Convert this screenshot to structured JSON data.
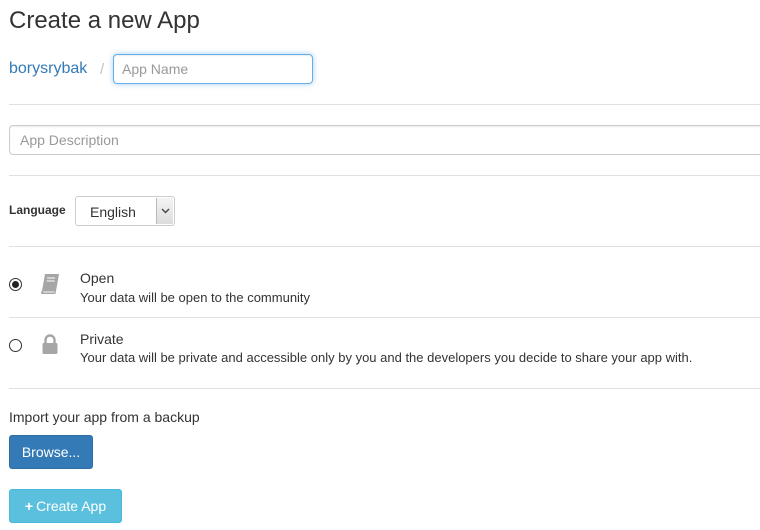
{
  "header": {
    "title": "Create a new App"
  },
  "owner": {
    "name": "borysrybak",
    "separator": "/"
  },
  "app_name": {
    "placeholder": "App Name",
    "value": ""
  },
  "description": {
    "placeholder": "App Description",
    "value": ""
  },
  "language": {
    "label": "Language",
    "selected": "English",
    "icon": "chevron-down-icon"
  },
  "visibility": {
    "selected": "Open",
    "options": [
      {
        "title": "Open",
        "description": "Your data will be open to the community",
        "icon": "book-icon",
        "checked": true
      },
      {
        "title": "Private",
        "description": "Your data will be private and accessible only by you and the developers you decide to share your app with.",
        "icon": "lock-icon",
        "checked": false
      }
    ]
  },
  "import": {
    "label": "Import your app from a backup",
    "browse_label": "Browse..."
  },
  "create_button": {
    "icon": "plus-icon",
    "label": "Create App"
  },
  "colors": {
    "link": "#337ab7",
    "primary": "#337ab7",
    "info": "#5bc0de",
    "focus": "#66afe9",
    "icon_gray": "#a6a6a6"
  }
}
